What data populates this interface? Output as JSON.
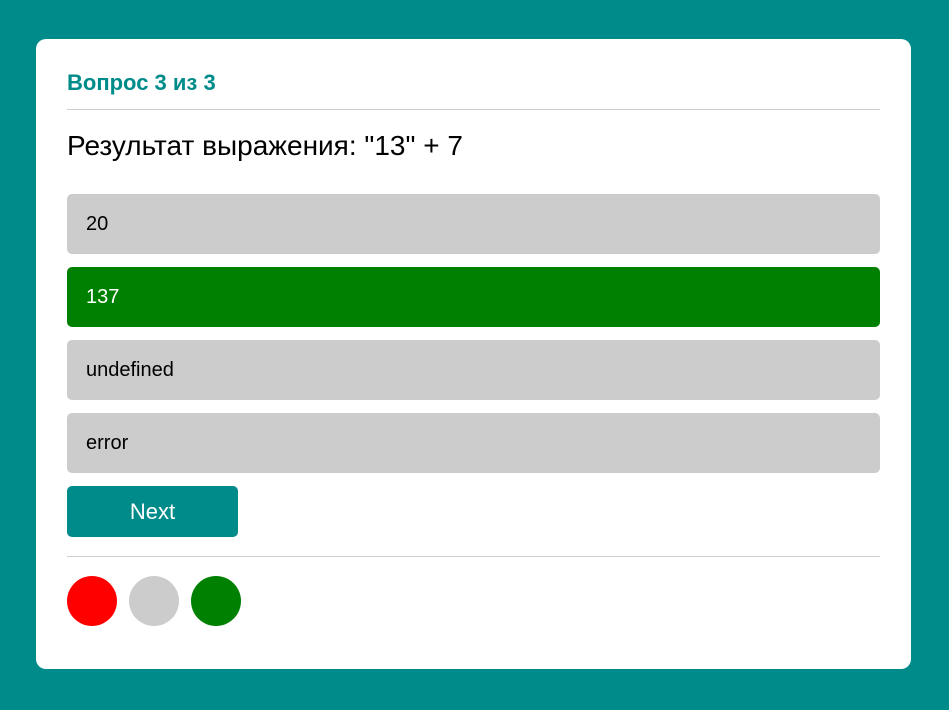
{
  "quiz": {
    "progress_label": "Вопрос 3 из 3",
    "question_text": "Результат выражения: \"13\" + 7",
    "answers": [
      {
        "label": "20",
        "state": "default"
      },
      {
        "label": "137",
        "state": "correct"
      },
      {
        "label": "undefined",
        "state": "default"
      },
      {
        "label": "error",
        "state": "default"
      }
    ],
    "next_label": "Next",
    "results": [
      {
        "status": "wrong",
        "color": "#ff0000"
      },
      {
        "status": "unanswered",
        "color": "#cccccc"
      },
      {
        "status": "correct",
        "color": "#008000"
      }
    ]
  },
  "colors": {
    "background": "#008b8b",
    "accent": "#008b8b",
    "correct": "#008000",
    "wrong": "#ff0000",
    "neutral": "#cccccc"
  }
}
